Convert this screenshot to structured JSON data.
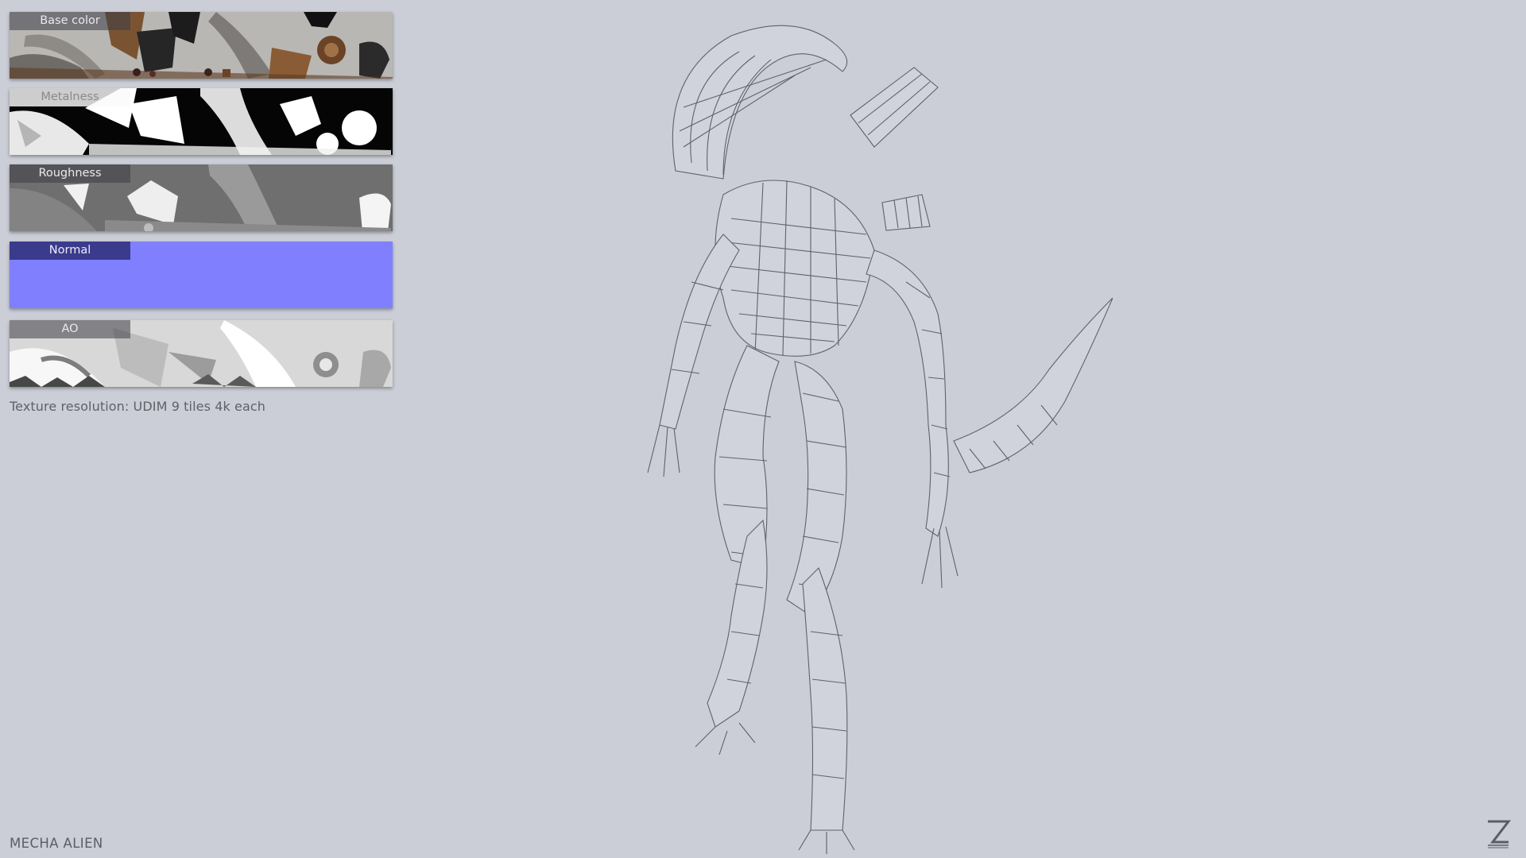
{
  "textures": [
    {
      "label": "Base color"
    },
    {
      "label": "Metalness"
    },
    {
      "label": "Roughness"
    },
    {
      "label": "Normal"
    },
    {
      "label": "AO"
    }
  ],
  "resolution_note": "Texture resolution: UDIM 9 tiles 4k each",
  "project_title": "MECHA ALIEN",
  "colors": {
    "background": "#cbced7",
    "normal_map": "#8080fe",
    "wire": "#4d5058"
  },
  "icons": {
    "logo": "z-logo-icon"
  }
}
